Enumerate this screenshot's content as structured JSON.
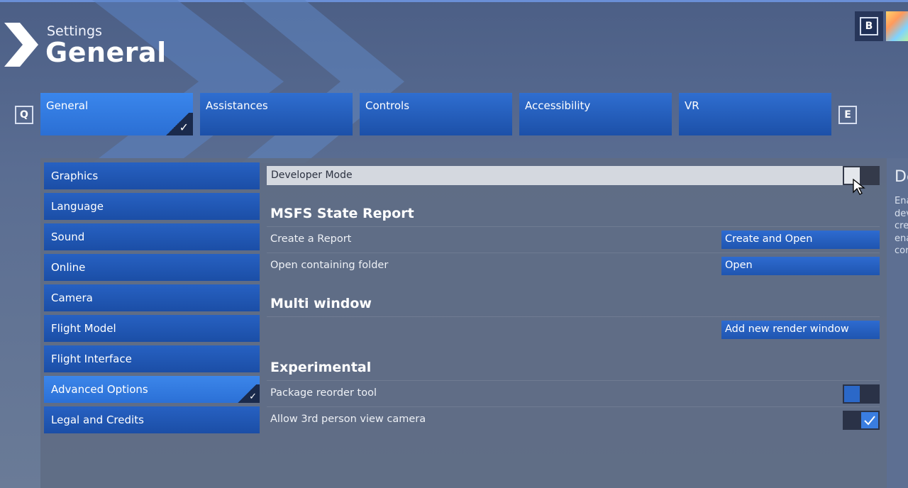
{
  "header": {
    "subtitle": "Settings",
    "title": "General"
  },
  "keys": {
    "b": "B",
    "q": "Q",
    "e": "E"
  },
  "tabs": [
    {
      "label": "General",
      "active": true
    },
    {
      "label": "Assistances",
      "active": false
    },
    {
      "label": "Controls",
      "active": false
    },
    {
      "label": "Accessibility",
      "active": false
    },
    {
      "label": "VR",
      "active": false
    }
  ],
  "sidebar": {
    "items": [
      {
        "label": "Graphics"
      },
      {
        "label": "Language"
      },
      {
        "label": "Sound"
      },
      {
        "label": "Online"
      },
      {
        "label": "Camera"
      },
      {
        "label": "Flight Model"
      },
      {
        "label": "Flight Interface"
      },
      {
        "label": "Advanced Options",
        "active": true
      },
      {
        "label": "Legal and Credits"
      }
    ]
  },
  "content": {
    "developer_mode": {
      "label": "Developer Mode",
      "enabled": false
    },
    "state_report": {
      "title": "MSFS State Report",
      "create_label": "Create a Report",
      "create_button": "Create and Open",
      "folder_label": "Open containing folder",
      "folder_button": "Open"
    },
    "multi_window": {
      "title": "Multi window",
      "add_button": "Add new render window"
    },
    "experimental": {
      "title": "Experimental",
      "package_label": "Package reorder tool",
      "package_enabled": false,
      "camera_label": "Allow 3rd person view camera",
      "camera_enabled": true
    }
  },
  "description_panel": {
    "title": "De",
    "lines": [
      "Ena",
      "dev",
      "cre",
      "ena",
      "cor"
    ]
  },
  "colors": {
    "accent": "#2b6fd4",
    "tab": "#1c50a8",
    "background": "#5a6d92"
  }
}
